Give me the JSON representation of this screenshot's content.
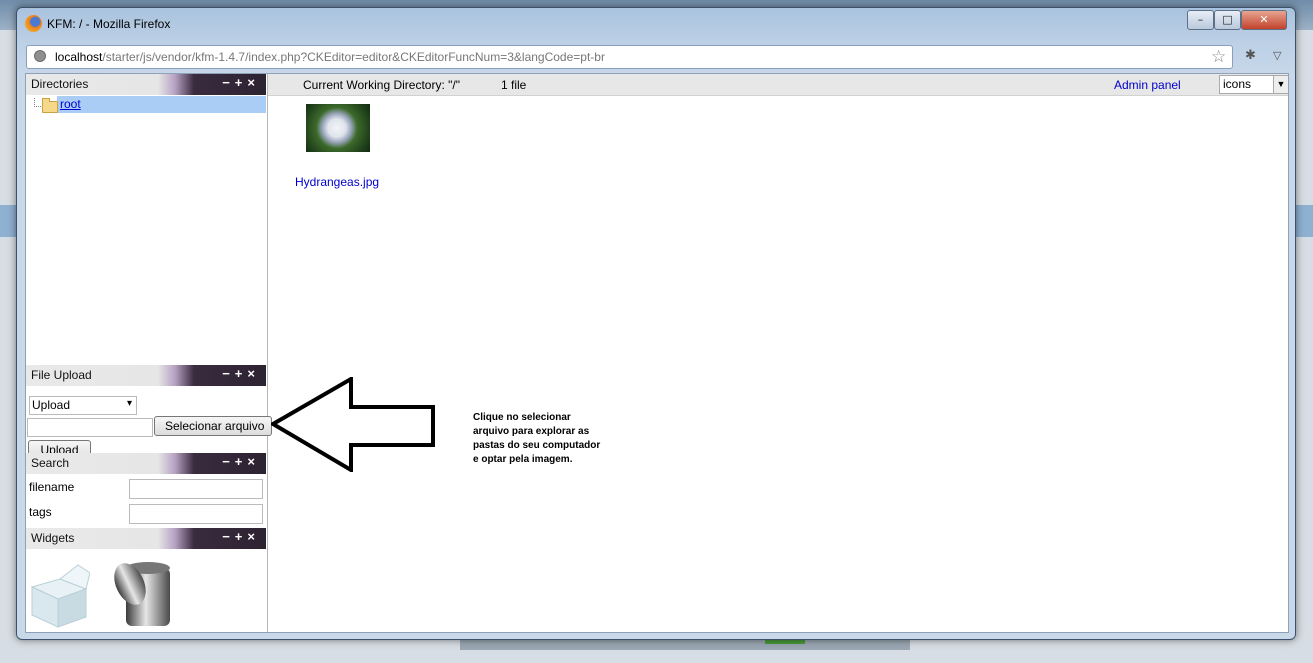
{
  "window": {
    "title": "KFM: / - Mozilla Firefox",
    "min_symbol": "–",
    "max_symbol": "□",
    "close_symbol": "✕"
  },
  "urlbar": {
    "host": "localhost",
    "path": "/starter/js/vendor/kfm-1.4.7/index.php?CKEditor=editor&CKEditorFuncNum=3&langCode=pt-br",
    "star": "☆"
  },
  "panels": {
    "buttons": "−+×",
    "directories": {
      "title": "Directories",
      "root_label": "root"
    },
    "file_upload": {
      "title": "File Upload",
      "mode_value": "Upload",
      "browse_label": "Selecionar arquivo",
      "upload_label": "Upload"
    },
    "search": {
      "title": "Search",
      "filename_label": "filename",
      "tags_label": "tags"
    },
    "widgets": {
      "title": "Widgets"
    }
  },
  "main": {
    "cwd": "Current Working Directory: \"/\"",
    "file_count": "1 file",
    "admin_link": "Admin panel",
    "view_mode": "icons",
    "files": [
      {
        "name": "Hydrangeas.jpg"
      }
    ]
  },
  "annotation": {
    "text": "Clique no selecionar arquivo para explorar as pastas do seu computador e optar pela imagem."
  }
}
